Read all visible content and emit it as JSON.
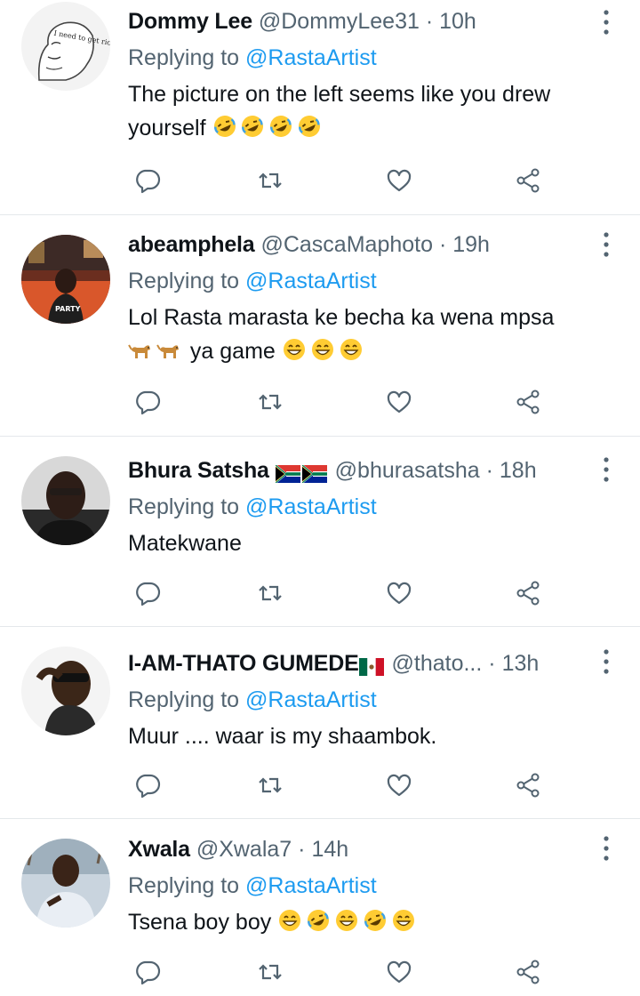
{
  "replying_label": "Replying to",
  "replies": [
    {
      "display_name": "Dommy Lee",
      "handle": "@DommyLee31",
      "separator": "·",
      "time": "10h",
      "replying_to": "@RastaArtist",
      "text_line1": "The picture on the left seems like you drew",
      "text_line2": "yourself",
      "avatar_caption": "I need to get rich"
    },
    {
      "display_name": "abeamphela",
      "handle": "@CascaMaphoto",
      "separator": "·",
      "time": "19h",
      "replying_to": "@RastaArtist",
      "text_line1": "Lol Rasta marasta ke becha ka wena mpsa",
      "text_line2": "ya game",
      "avatar_caption": "PARTY"
    },
    {
      "display_name": "Bhura Satsha",
      "handle": "@bhurasatsha",
      "separator": "·",
      "time": "18h",
      "replying_to": "@RastaArtist",
      "text_line1": "Matekwane"
    },
    {
      "display_name": "I-AM-THATO GUMEDE",
      "handle": "@thato...",
      "separator": "·",
      "time": "13h",
      "replying_to": "@RastaArtist",
      "text_line1": "Muur .... waar is my shaambok."
    },
    {
      "display_name": "Xwala",
      "handle": "@Xwala7",
      "separator": "·",
      "time": "14h",
      "replying_to": "@RastaArtist",
      "text_line1": "Tsena boy boy"
    }
  ],
  "colors": {
    "text_primary": "#0f1419",
    "text_secondary": "#536471",
    "mention_blue": "#1d9bf0",
    "divider": "#e4e8eb"
  },
  "icons": {
    "reply": "speech-bubble-icon",
    "retweet": "retweet-icon",
    "like": "heart-icon",
    "share": "share-icon",
    "more": "vertical-dots-icon"
  }
}
